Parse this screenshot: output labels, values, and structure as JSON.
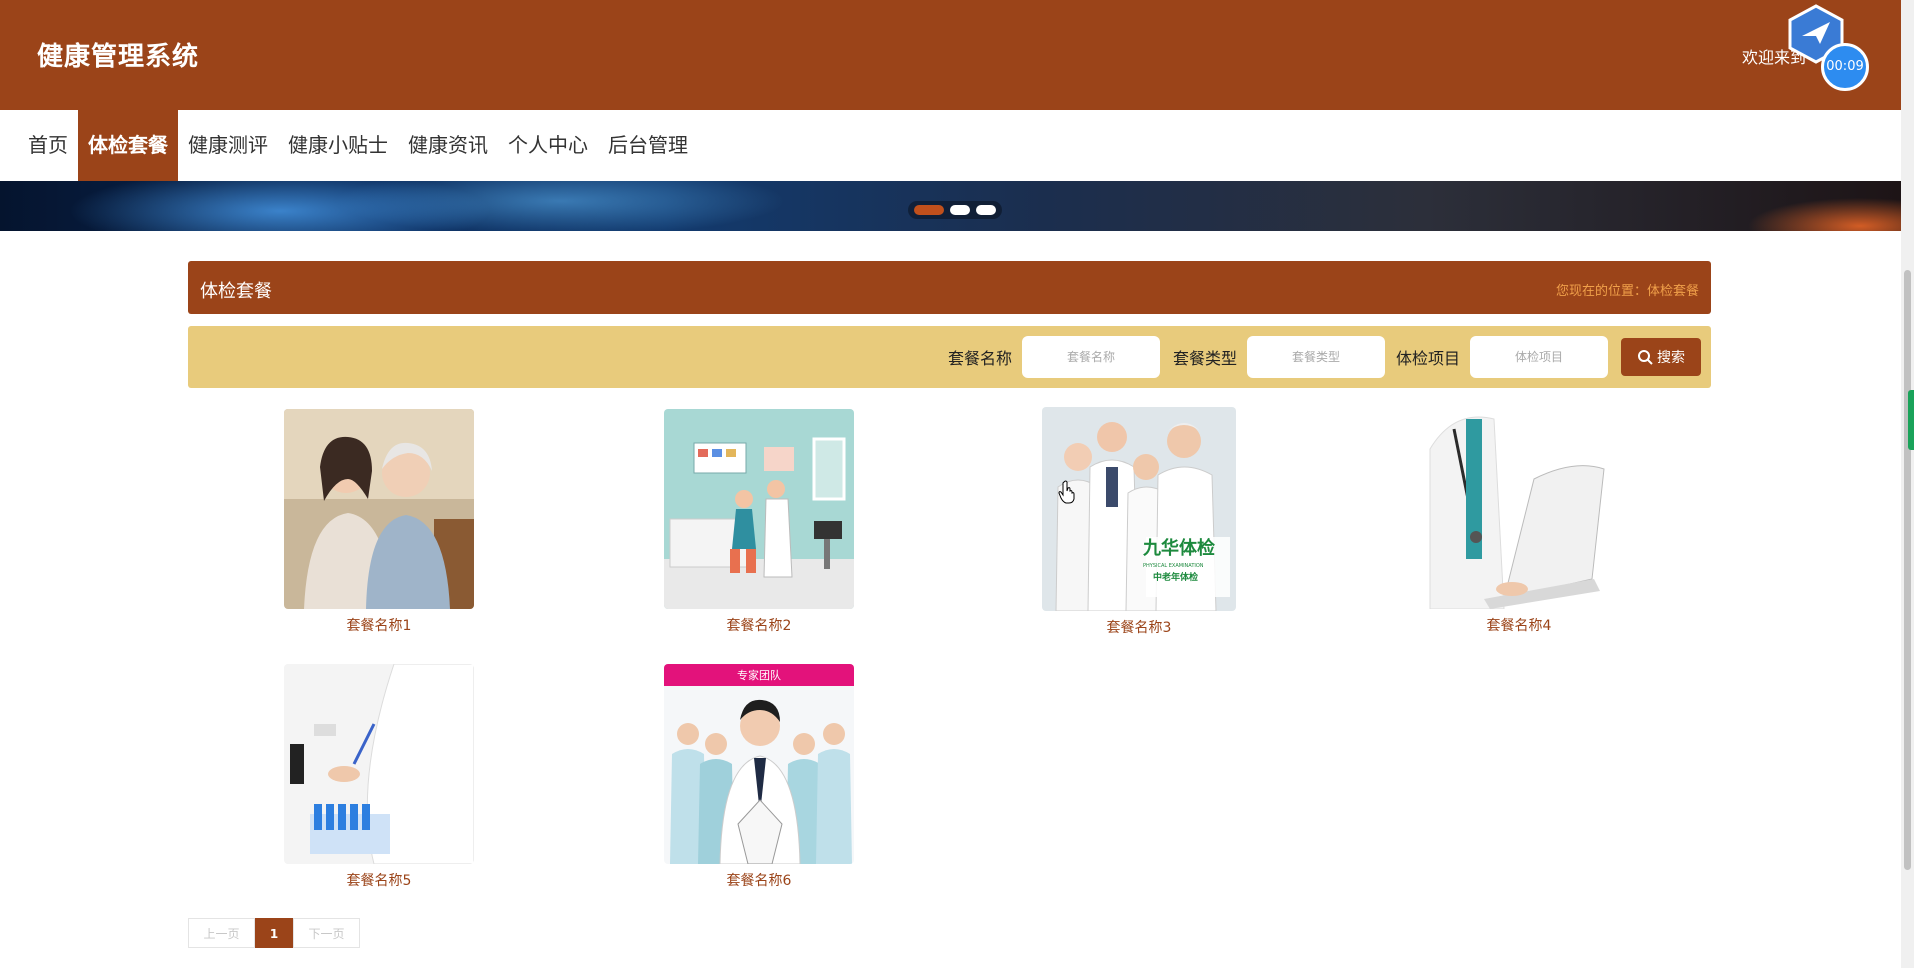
{
  "header": {
    "site_title": "健康管理系统",
    "welcome_text": "欢迎来到",
    "timer": "00:09"
  },
  "nav": {
    "items": [
      {
        "label": "首页"
      },
      {
        "label": "体检套餐",
        "active": true
      },
      {
        "label": "健康测评"
      },
      {
        "label": "健康小贴士"
      },
      {
        "label": "健康资讯"
      },
      {
        "label": "个人中心"
      },
      {
        "label": "后台管理"
      }
    ]
  },
  "banner": {
    "slides": 3,
    "active_slide": 1
  },
  "section": {
    "title": "体检套餐",
    "breadcrumb": "您现在的位置：体检套餐"
  },
  "search": {
    "fields": [
      {
        "label": "套餐名称",
        "placeholder": "套餐名称"
      },
      {
        "label": "套餐类型",
        "placeholder": "套餐类型"
      },
      {
        "label": "体检项目",
        "placeholder": "体检项目"
      }
    ],
    "button_label": "搜索"
  },
  "packages": [
    {
      "name": "套餐名称1",
      "image": "mother-daughter-photo"
    },
    {
      "name": "套餐名称2",
      "image": "clinic-illustration"
    },
    {
      "name": "套餐名称3",
      "image": "medical-team-photo",
      "image_text": "九华体检",
      "image_subtext": "PHYSICAL EXAMINATION",
      "image_caption": "中老年体检"
    },
    {
      "name": "套餐名称4",
      "image": "doctor-laptop-photo"
    },
    {
      "name": "套餐名称5",
      "image": "lab-test-tubes-photo"
    },
    {
      "name": "套餐名称6",
      "image": "expert-team-photo",
      "image_text": "专家团队"
    }
  ],
  "pagination": {
    "prev_label": "上一页",
    "current_page": "1",
    "next_label": "下一页"
  },
  "colors": {
    "brand": "#9b4419",
    "search_bg": "#e8cb7c",
    "breadcrumb": "#f0a04a",
    "timer": "#2d8cf0"
  }
}
